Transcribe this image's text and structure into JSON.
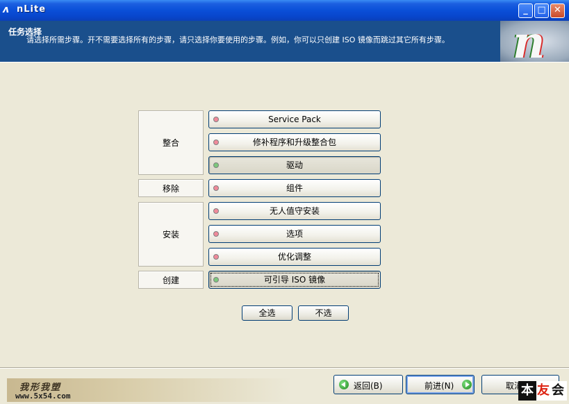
{
  "window": {
    "title": "nLite",
    "minimize": "_",
    "maximize": "□",
    "close": "✕"
  },
  "header": {
    "title": "任务选择",
    "description": "请选择所需步骤。开不需要选择所有的步骤，请只选择你要使用的步骤。例如，你可以只创建 ISO 镜像而跳过其它所有步骤。"
  },
  "groups": {
    "integrate": "整合",
    "remove": "移除",
    "setup": "安装",
    "create": "创建"
  },
  "tasks": {
    "service_pack": "Service Pack",
    "hotfixes": "修补程序和升级整合包",
    "drivers": "驱动",
    "components": "组件",
    "unattended": "无人值守安装",
    "options": "选项",
    "tweaks": "优化调整",
    "bootable_iso": "可引导 ISO 镜像"
  },
  "colors": {
    "task_off": "#f08a9a",
    "task_on": "#7cc87c"
  },
  "selection": {
    "select_all": "全选",
    "select_none": "不选"
  },
  "nav": {
    "back": "返回(B)",
    "next": "前进(N)",
    "cancel": "取消"
  },
  "watermark": {
    "script": "我形我塑",
    "url": "www.5x54.com"
  },
  "badge": {
    "c1": "本",
    "c2": "友",
    "c3": "会"
  }
}
